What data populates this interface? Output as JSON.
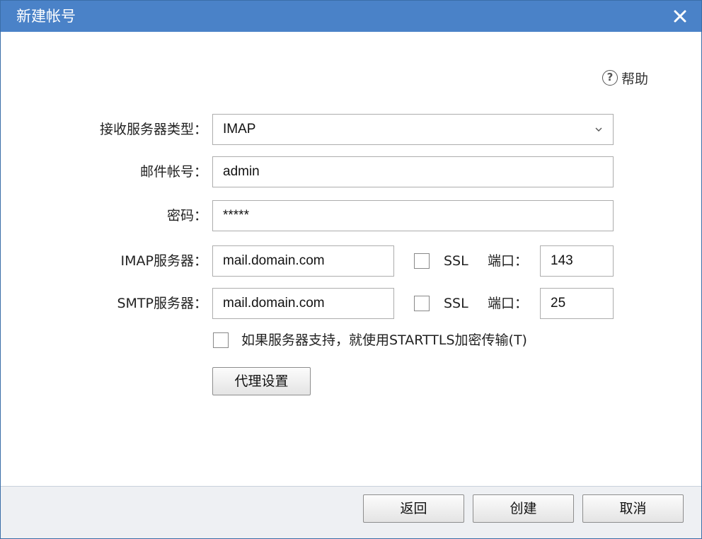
{
  "window": {
    "title": "新建帐号",
    "close_icon": "close-icon"
  },
  "help": {
    "icon": "question-circle-icon",
    "label": "帮助"
  },
  "form": {
    "server_type": {
      "label": "接收服务器类型：",
      "value": "IMAP",
      "dropdown_icon": "chevron-down-icon"
    },
    "account": {
      "label": "邮件帐号：",
      "value": "admin"
    },
    "password": {
      "label": "密码：",
      "value": "*****"
    },
    "imap": {
      "label": "IMAP服务器：",
      "value": "mail.domain.com",
      "ssl_label": "SSL",
      "ssl_checked": false,
      "port_label": "端口：",
      "port_value": "143"
    },
    "smtp": {
      "label": "SMTP服务器：",
      "value": "mail.domain.com",
      "ssl_label": "SSL",
      "ssl_checked": false,
      "port_label": "端口：",
      "port_value": "25"
    },
    "starttls": {
      "label": "如果服务器支持，就使用STARTTLS加密传输(T)",
      "checked": false
    },
    "proxy_button": "代理设置"
  },
  "footer": {
    "back_label": "返回",
    "create_label": "创建",
    "cancel_label": "取消"
  },
  "colors": {
    "titlebar": "#4a82c8",
    "footer_bg": "#eef0f3"
  }
}
